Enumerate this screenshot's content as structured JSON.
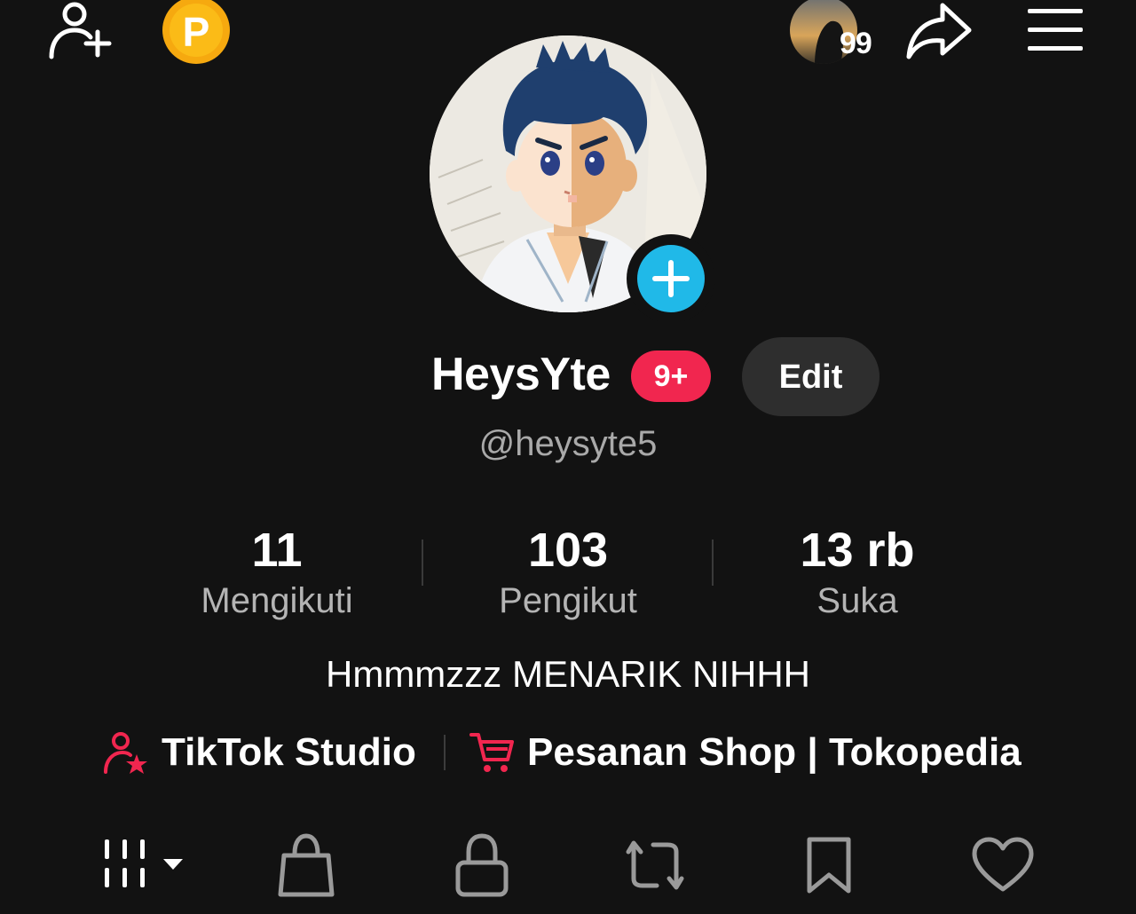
{
  "topbar": {
    "add_friend_icon": "person-plus-icon",
    "coin_icon": "coin-p-icon",
    "coin_letter": "P",
    "story_count": "99",
    "share_icon": "share-arrow-icon",
    "menu_icon": "hamburger-menu-icon"
  },
  "profile": {
    "name": "HeysYte",
    "badge": "9+",
    "edit_label": "Edit",
    "handle": "@heysyte5",
    "bio": "Hmmmzzz MENARIK NIHHH"
  },
  "stats": {
    "following": {
      "value": "11",
      "label": "Mengikuti"
    },
    "followers": {
      "value": "103",
      "label": "Pengikut"
    },
    "likes": {
      "value": "13 rb",
      "label": "Suka"
    }
  },
  "links": {
    "studio": "TikTok Studio",
    "shop": "Pesanan Shop | Tokopedia"
  },
  "tabs": [
    {
      "name": "videos-grid-icon"
    },
    {
      "name": "shop-bag-icon"
    },
    {
      "name": "private-lock-icon"
    },
    {
      "name": "repost-icon"
    },
    {
      "name": "bookmark-icon"
    },
    {
      "name": "heart-icon"
    }
  ],
  "colors": {
    "background": "#121212",
    "accent_red": "#f1264f",
    "accent_blue": "#20b9e8",
    "coin": "#f6a90f"
  }
}
